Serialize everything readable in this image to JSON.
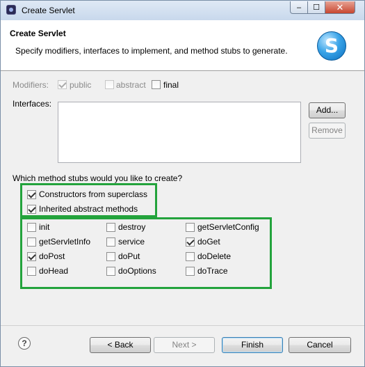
{
  "window": {
    "title": "Create Servlet",
    "close_glyph": "✕",
    "min_glyph": "–",
    "max_glyph": "☐"
  },
  "banner": {
    "heading": "Create Servlet",
    "description": "Specify modifiers, interfaces to implement, and method stubs to generate.",
    "logo_letter": "S"
  },
  "modifiers": {
    "label": "Modifiers:",
    "public": {
      "label": "public",
      "checked": true,
      "enabled": false
    },
    "abstract": {
      "label": "abstract",
      "checked": false,
      "enabled": false
    },
    "final": {
      "label": "final",
      "checked": false,
      "enabled": true
    }
  },
  "interfaces": {
    "label": "Interfaces:",
    "add_label": "Add...",
    "remove_label": "Remove"
  },
  "stubs": {
    "question": "Which method stubs would you like to create?",
    "constructors": {
      "label": "Constructors from superclass",
      "checked": true
    },
    "inherited": {
      "label": "Inherited abstract methods",
      "checked": true
    },
    "methods": [
      {
        "label": "init",
        "checked": false
      },
      {
        "label": "destroy",
        "checked": false
      },
      {
        "label": "getServletConfig",
        "checked": false
      },
      {
        "label": "getServletInfo",
        "checked": false
      },
      {
        "label": "service",
        "checked": false
      },
      {
        "label": "doGet",
        "checked": true
      },
      {
        "label": "doPost",
        "checked": true
      },
      {
        "label": "doPut",
        "checked": false
      },
      {
        "label": "doDelete",
        "checked": false
      },
      {
        "label": "doHead",
        "checked": false
      },
      {
        "label": "doOptions",
        "checked": false
      },
      {
        "label": "doTrace",
        "checked": false
      }
    ]
  },
  "footer": {
    "help_glyph": "?",
    "back_label": "< Back",
    "next_label": "Next >",
    "finish_label": "Finish",
    "cancel_label": "Cancel"
  },
  "colors": {
    "highlight": "#23a33c"
  }
}
